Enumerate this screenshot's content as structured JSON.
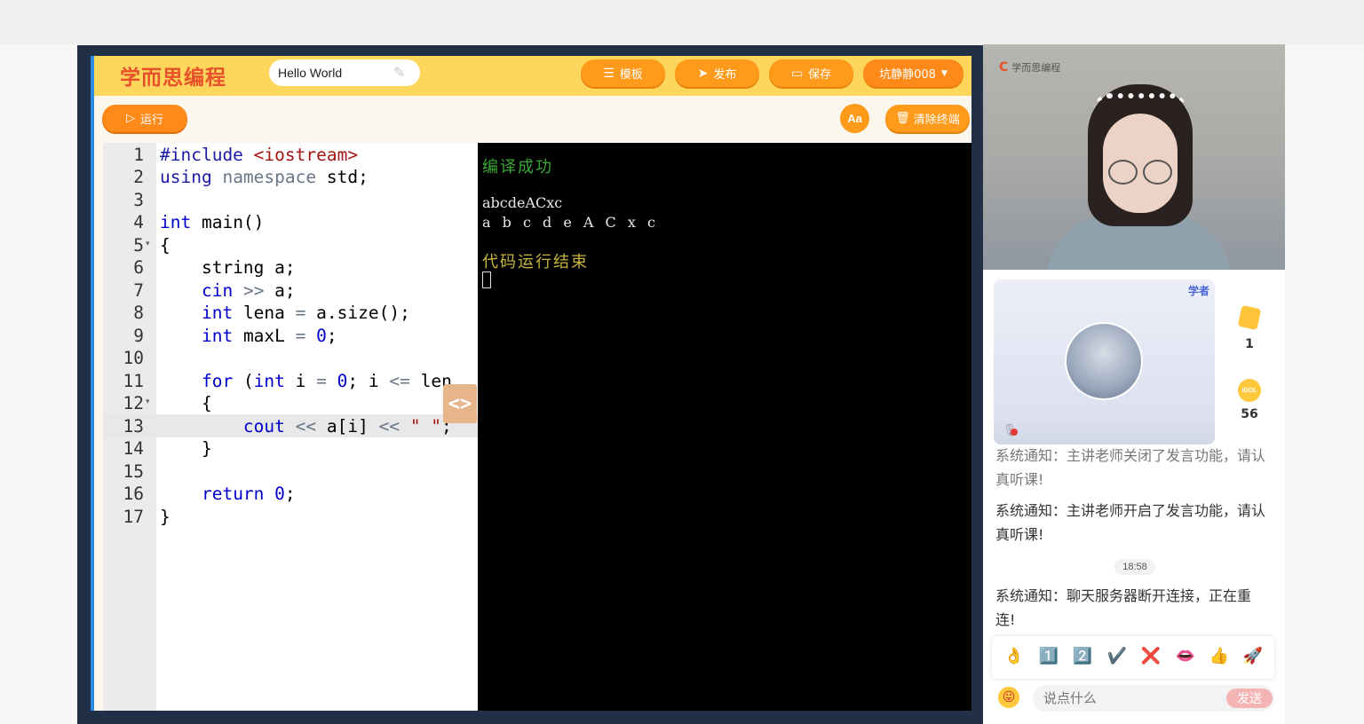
{
  "ide": {
    "logo": "学而思编程",
    "project_title": "Hello World",
    "buttons": {
      "template": "模板",
      "publish": "发布",
      "save": "保存",
      "user": "坑静静008",
      "run": "运行",
      "font": "Aa",
      "clear_terminal": "清除终端"
    },
    "code_lines": [
      {
        "n": "1",
        "text": "#include <iostream>"
      },
      {
        "n": "2",
        "text": "using namespace std;"
      },
      {
        "n": "3",
        "text": ""
      },
      {
        "n": "4",
        "text": "int main()"
      },
      {
        "n": "5",
        "text": "{"
      },
      {
        "n": "6",
        "text": "    string a;"
      },
      {
        "n": "7",
        "text": "    cin >> a;"
      },
      {
        "n": "8",
        "text": "    int lena = a.size();"
      },
      {
        "n": "9",
        "text": "    int maxL = 0;"
      },
      {
        "n": "10",
        "text": ""
      },
      {
        "n": "11",
        "text": "    for (int i = 0; i <= len"
      },
      {
        "n": "12",
        "text": "    {"
      },
      {
        "n": "13",
        "text": "        cout << a[i] << \" \";"
      },
      {
        "n": "14",
        "text": "    }"
      },
      {
        "n": "15",
        "text": ""
      },
      {
        "n": "16",
        "text": "    return 0;"
      },
      {
        "n": "17",
        "text": "}"
      }
    ],
    "splitter_label": "<>",
    "terminal": {
      "compile_status": "编译成功",
      "output_1": "abcdeACxc",
      "output_2": "a b c d e A C x c",
      "end_status": "代码运行结束"
    }
  },
  "live": {
    "video_logo": "学而思编程",
    "card_tag": "学者",
    "stats": {
      "cards": "1",
      "coins": "56",
      "coin_label": "IDOL"
    },
    "messages": [
      "系统通知：主讲老师关闭了发言功能，请认真听课!",
      "系统通知：主讲老师开启了发言功能，请认真听课!",
      "系统通知：聊天服务器断开连接，正在重连!"
    ],
    "timestamp": "18:58",
    "emojis": [
      "👌",
      "1️⃣",
      "2️⃣",
      "✔️",
      "❌",
      "👄",
      "👍",
      "🚀"
    ],
    "input_placeholder": "说点什么",
    "send": "发送"
  },
  "colors": {
    "header_yellow": "#ffd65c",
    "button_orange": "#ff9a1a",
    "terminal_bg": "#000000",
    "success_green": "#3aa835",
    "end_yellow": "#c8b53d"
  }
}
